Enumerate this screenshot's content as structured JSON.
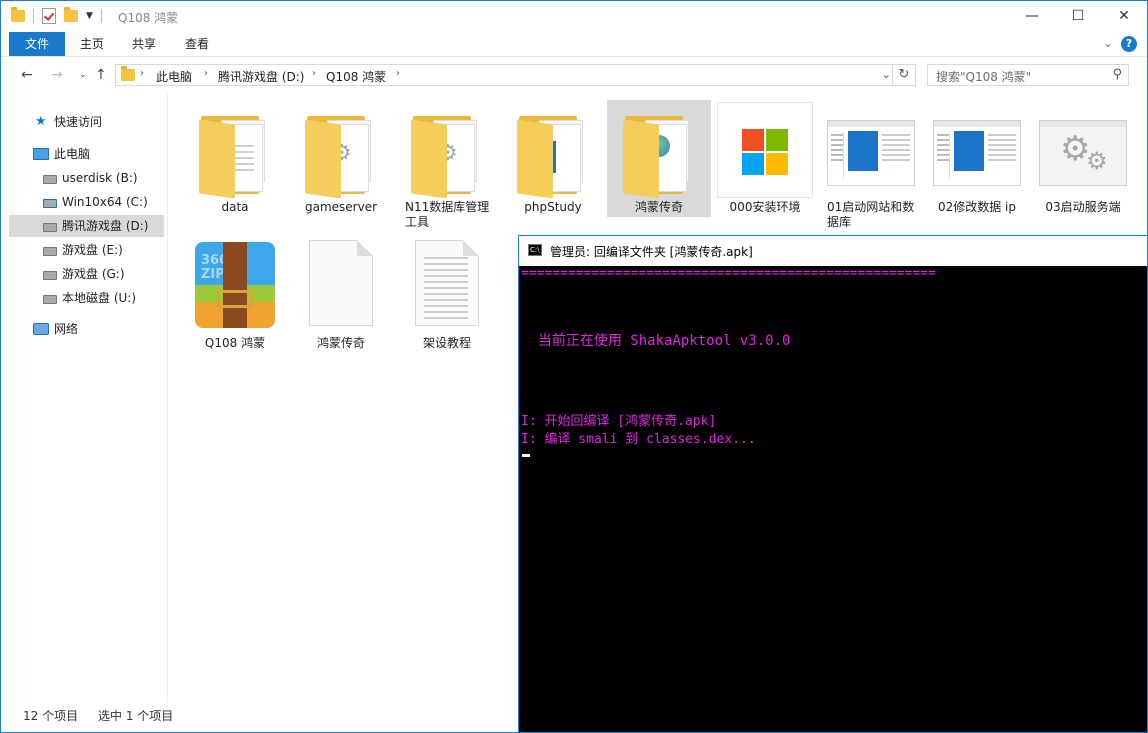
{
  "window": {
    "title": "Q108 鸿蒙",
    "controls": {
      "minimize": "—",
      "maximize": "☐",
      "close": "✕"
    }
  },
  "ribbon": {
    "tabs": [
      "文件",
      "主页",
      "共享",
      "查看"
    ],
    "help": "?"
  },
  "address": {
    "crumbs": [
      "此电脑",
      "腾讯游戏盘 (D:)",
      "Q108 鸿蒙"
    ],
    "search_placeholder": "搜索\"Q108 鸿蒙\""
  },
  "nav": {
    "quick_access": "快速访问",
    "this_pc": "此电脑",
    "drives": [
      "userdisk (B:)",
      "Win10x64 (C:)",
      "腾讯游戏盘 (D:)",
      "游戏盘 (E:)",
      "游戏盘 (G:)",
      "本地磁盘 (U:)"
    ],
    "network": "网络"
  },
  "items": [
    {
      "label": "data",
      "kind": "folder-doc"
    },
    {
      "label": "gameserver",
      "kind": "folder-gear"
    },
    {
      "label": "N11数据库管理工具",
      "kind": "folder-gear"
    },
    {
      "label": "phpStudy",
      "kind": "folder-blue"
    },
    {
      "label": "鸿蒙传奇",
      "kind": "folder-globe"
    },
    {
      "label": "000安装环境",
      "kind": "ms-logo"
    },
    {
      "label": "01启动网站和数据库",
      "kind": "window"
    },
    {
      "label": "02修改数据 ip",
      "kind": "window"
    },
    {
      "label": "03启动服务端",
      "kind": "gear-window"
    },
    {
      "label": "Q108 鸿蒙",
      "kind": "zip"
    },
    {
      "label": "鸿蒙传奇",
      "kind": "blank"
    },
    {
      "label": "架设教程",
      "kind": "text"
    }
  ],
  "zip_icon_text": "360\nZIP",
  "status": {
    "count": "12 个项目",
    "selected": "选中 1 个项目"
  },
  "console": {
    "title": "管理员:  回编译文件夹 [鸿蒙传奇.apk]",
    "icon_text": "C:\\",
    "lines": [
      "=====================================================",
      "  当前正在使用 ShakaApktool v3.0.0",
      "I: 开始回编译 [鸿蒙传奇.apk]",
      "I: 编译 smali 到 classes.dex..."
    ]
  }
}
